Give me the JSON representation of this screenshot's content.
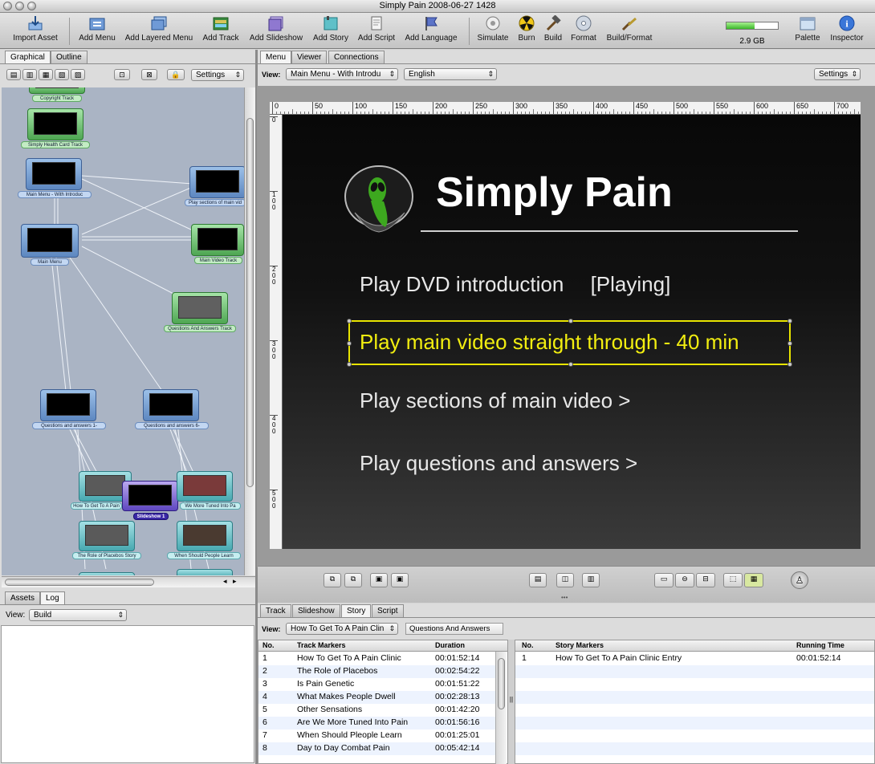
{
  "window": {
    "title": "Simply Pain 2008-06-27 1428"
  },
  "toolbar": {
    "import_asset": "Import Asset",
    "add_menu": "Add Menu",
    "add_layered_menu": "Add Layered Menu",
    "add_track": "Add Track",
    "add_slideshow": "Add Slideshow",
    "add_story": "Add Story",
    "add_script": "Add Script",
    "add_language": "Add Language",
    "simulate": "Simulate",
    "burn": "Burn",
    "build": "Build",
    "format": "Format",
    "build_format": "Build/Format",
    "disc_meter_label": "2.9 GB",
    "disc_meter_fill": 0.55,
    "palette": "Palette",
    "inspector": "Inspector"
  },
  "left_tabs": {
    "graphical": "Graphical",
    "outline": "Outline"
  },
  "left_toolbar": {
    "settings": "Settings"
  },
  "graph": {
    "nodes": {
      "copyright": "Copyright Track",
      "health_card": "Simply Health Card Track",
      "main_menu_intro": "Main Menu - With Introduc",
      "sections": "Play sections of main vid",
      "main_menu": "Main Menu",
      "main_video": "Main Video Track",
      "qa_track": "Questions And Answers Track",
      "qa1": "Questions and answers 1-",
      "qa6": "Questions and answers 6-",
      "pain_clinic": "How To Get To A Pain",
      "slideshow": "Slideshow 1",
      "tuned": "We More Tuned Into Pa",
      "placebos": "The Role of Placebos Story",
      "learn": "When Should People Learn"
    }
  },
  "bottom_left_tabs": {
    "assets": "Assets",
    "log": "Log"
  },
  "log_view": {
    "label": "View:",
    "value": "Build"
  },
  "right_tabs": {
    "menu": "Menu",
    "viewer": "Viewer",
    "connections": "Connections"
  },
  "menu_editor": {
    "view_label": "View:",
    "view_value": "Main Menu - With Introdu",
    "language_value": "English",
    "settings": "Settings"
  },
  "ruler": {
    "h_ticks": [
      "0",
      "50",
      "100",
      "150",
      "200",
      "250",
      "300",
      "350",
      "400",
      "450",
      "500",
      "550",
      "600",
      "650",
      "700"
    ],
    "v_ticks": [
      "0",
      "100",
      "200",
      "300",
      "400",
      "500"
    ]
  },
  "menu": {
    "title": "Simply Pain",
    "items": [
      {
        "text": "Play DVD introduction",
        "status": "[Playing]"
      },
      {
        "text": "Play main video straight through -  40 min"
      },
      {
        "text": "Play sections of main video >"
      },
      {
        "text": "Play questions and answers >"
      }
    ]
  },
  "bottom_tabs": {
    "track": "Track",
    "slideshow": "Slideshow",
    "story": "Story",
    "script": "Script"
  },
  "story_editor": {
    "view_label": "View:",
    "view_value": "How To Get To A Pain Clin",
    "story_name": "Questions And Answers"
  },
  "track_markers": {
    "headers": {
      "no": "No.",
      "name": "Track Markers",
      "duration": "Duration"
    },
    "rows": [
      {
        "no": "1",
        "name": "How To Get To A Pain Clinic",
        "duration": "00:01:52:14"
      },
      {
        "no": "2",
        "name": "The Role of Placebos",
        "duration": "00:02:54:22"
      },
      {
        "no": "3",
        "name": "Is Pain Genetic",
        "duration": "00:01:51:22"
      },
      {
        "no": "4",
        "name": "What Makes People Dwell",
        "duration": "00:02:28:13"
      },
      {
        "no": "5",
        "name": "Other Sensations",
        "duration": "00:01:42:20"
      },
      {
        "no": "6",
        "name": "Are We More Tuned Into Pain",
        "duration": "00:01:56:16"
      },
      {
        "no": "7",
        "name": "When Should Pleople Learn",
        "duration": "00:01:25:01"
      },
      {
        "no": "8",
        "name": "Day to Day Combat Pain",
        "duration": "00:05:42:14"
      }
    ]
  },
  "story_markers": {
    "headers": {
      "no": "No.",
      "name": "Story Markers",
      "running": "Running Time"
    },
    "rows": [
      {
        "no": "1",
        "name": "How To Get To A Pain Clinic Entry",
        "running": "00:01:52:14"
      }
    ]
  }
}
